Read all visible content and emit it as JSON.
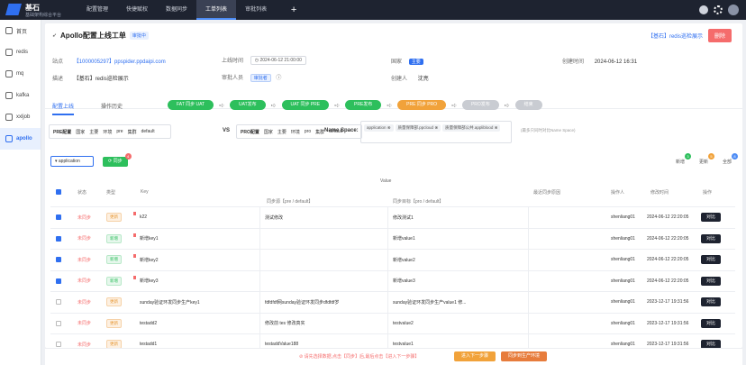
{
  "app": {
    "title": "基石",
    "subtitle": "基础架构综合平台"
  },
  "topnav": [
    "配置管理",
    "快捷赋权",
    "数据同步",
    "工单列表",
    "审批列表"
  ],
  "topnav_active": 3,
  "sidebar": [
    {
      "label": "首页",
      "icon": "home-icon"
    },
    {
      "label": "redis",
      "icon": "redis-icon"
    },
    {
      "label": "mq",
      "icon": "mq-icon"
    },
    {
      "label": "kafka",
      "icon": "kafka-icon"
    },
    {
      "label": "xxljob",
      "icon": "job-icon"
    },
    {
      "label": "apollo",
      "icon": "apollo-icon"
    }
  ],
  "sidebar_active": 5,
  "ticket": {
    "title": "Apollo配置上线工单",
    "status": "审批中",
    "link_text": "【基石】redis巡检展示",
    "delete_label": "删除",
    "fields": {
      "site_label": "站点",
      "site_value": "【1000005297】ppspider.ppdaipi.com",
      "online_time_label": "上线时间",
      "online_time_value": "2024-06-12 21:00:00",
      "country_label": "国家",
      "country_value": "主要",
      "created_label": "创建时间",
      "created_value": "2024-06-12 16:31",
      "desc_label": "描述",
      "desc_value": "【基石】redis巡检展示",
      "approver_label": "审批人员",
      "approver_value": "审批者",
      "creator_label": "创建人",
      "creator_value": "沈亮"
    }
  },
  "tabs": [
    "配置上线",
    "操作历史"
  ],
  "tabs_active": 0,
  "flow": [
    {
      "label": "FAT 同步 UAT",
      "state": "green"
    },
    {
      "label": "UAT发布",
      "state": "green"
    },
    {
      "label": "UAT 同步 PRE",
      "state": "green"
    },
    {
      "label": "PRE发布",
      "state": "green"
    },
    {
      "label": "PRE 同步 PRO",
      "state": "orange"
    },
    {
      "label": "PRO发布",
      "state": "gray"
    },
    {
      "label": "结束",
      "state": "gray"
    }
  ],
  "env_left": {
    "title": "PRE配置",
    "country_label": "国家",
    "country": "主要",
    "env_label": "环境",
    "env": "pre",
    "cluster_label": "集群",
    "cluster": "default"
  },
  "env_right": {
    "title": "PRO配置",
    "country_label": "国家",
    "country": "主要",
    "env_label": "环境",
    "env": "pro",
    "cluster_label": "集群",
    "cluster": "default"
  },
  "vs": "VS",
  "namespace": {
    "label": "Name Space:",
    "chips": [
      "application",
      "质量保障部.ppcloud",
      "质量保障部公共.appliblood"
    ],
    "hint": "(最多只同时对比Name Space)"
  },
  "controls": {
    "select_value": "application",
    "sync_label": "同步",
    "sync_badge": "4"
  },
  "legend": [
    {
      "label": "新增",
      "count": "3",
      "color": "#2dbf5c"
    },
    {
      "label": "更新",
      "count": "5",
      "color": "#f1a23a"
    },
    {
      "label": "全部",
      "count": "8",
      "color": "#4d8cf5"
    }
  ],
  "table": {
    "value_group": "Value",
    "headers": {
      "status": "状态",
      "type": "类型",
      "key": "Key",
      "pre": "同步源【pre / default】",
      "pro": "同步目标【pro / default】",
      "reason": "最近同步原因",
      "operator": "操作人",
      "mtime": "修改时间",
      "action": "操作"
    },
    "rows": [
      {
        "checked": true,
        "status": "未同步",
        "type": "更新",
        "tcolor": "orange",
        "flag": true,
        "key": "k22",
        "pre": "测试修改",
        "pro": "修改测试1",
        "reason": "",
        "operator": "shenliang01",
        "mtime": "2024-06-12 22:20:05",
        "action": "对比"
      },
      {
        "checked": true,
        "status": "未同步",
        "type": "新增",
        "tcolor": "green",
        "flag": true,
        "key": "新增key1",
        "pre": "",
        "pro": "新增value1",
        "reason": "",
        "operator": "shenliang01",
        "mtime": "2024-06-12 22:20:05",
        "action": "对比"
      },
      {
        "checked": true,
        "status": "未同步",
        "type": "新增",
        "tcolor": "green",
        "flag": true,
        "key": "新增key2",
        "pre": "",
        "pro": "新增value2",
        "reason": "",
        "operator": "shenliang01",
        "mtime": "2024-06-12 22:20:05",
        "action": "对比"
      },
      {
        "checked": true,
        "status": "未同步",
        "type": "新增",
        "tcolor": "green",
        "flag": true,
        "key": "新增key3",
        "pre": "",
        "pro": "新增value3",
        "reason": "",
        "operator": "shenliang01",
        "mtime": "2024-06-12 22:20:05",
        "action": "对比"
      },
      {
        "checked": false,
        "status": "未同步",
        "type": "更新",
        "tcolor": "orange",
        "flag": false,
        "key": "sunday验证环发同步生产key1",
        "pre": "fdfdfdf网sunday验证环发同步dfdfdf岁",
        "pro": "sunday验证环发同步生产value1 修...",
        "reason": "",
        "operator": "shenliang01",
        "mtime": "2023-12-17 19:31:56",
        "action": "对比"
      },
      {
        "checked": false,
        "status": "未同步",
        "type": "更新",
        "tcolor": "orange",
        "flag": false,
        "key": "testadd2",
        "pre": "修改前 tes 修改真实",
        "pro": "testvalue2",
        "reason": "",
        "operator": "shenliang01",
        "mtime": "2023-12-17 19:31:56",
        "action": "对比"
      },
      {
        "checked": false,
        "status": "未同步",
        "type": "更新",
        "tcolor": "orange",
        "flag": false,
        "key": "testadd1",
        "pre": "testaddValue188",
        "pro": "testvalue1",
        "reason": "",
        "operator": "shenliang01",
        "mtime": "2023-12-17 19:31:56",
        "action": "对比"
      }
    ]
  },
  "bottom": {
    "warning": "请先选择数据,点击【同步】后,最后点击【进入下一步骤】",
    "next_label": "进入下一步骤",
    "finish_label": "同步到生产环境"
  },
  "colors": {
    "primary": "#2f6ff0",
    "success": "#2dbf5c",
    "warning": "#f1a23a",
    "danger": "#f56c6c",
    "topbar": "#1e2330"
  }
}
